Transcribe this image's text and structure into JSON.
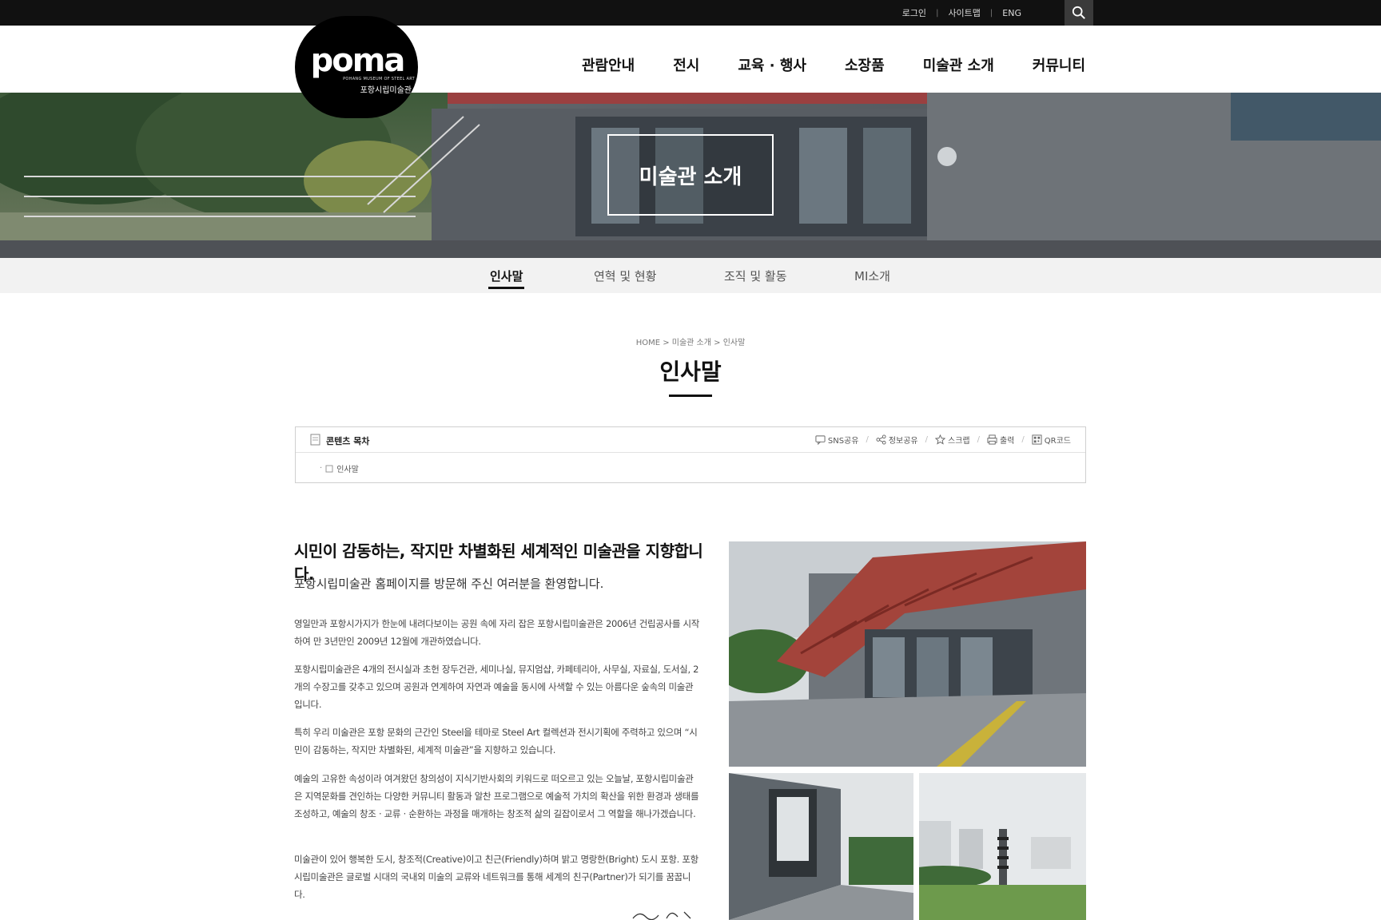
{
  "util": {
    "login": "로그인",
    "sitemap": "사이트맵",
    "eng": "ENG",
    "separator": "|"
  },
  "logo": {
    "word": "poma",
    "sub_en": "POHANG MUSEUM OF STEEL ART",
    "sub_ko": "포항시립미술관"
  },
  "gnb": [
    "관람안내",
    "전시",
    "교육 · 행사",
    "소장품",
    "미술관 소개",
    "커뮤니티"
  ],
  "hero": {
    "title": "미술관 소개"
  },
  "subnav": [
    "인사말",
    "연혁 및 현황",
    "조직 및 활동",
    "MI소개"
  ],
  "breadcrumb": "HOME > 미술관 소개 > 인사말",
  "page_title": "인사말",
  "contents": {
    "label": "콘텐츠 목차",
    "tools": [
      "SNS공유",
      "정보공유",
      "스크랩",
      "출력",
      "QR코드"
    ],
    "items": [
      "인사말"
    ],
    "slash": "/"
  },
  "article": {
    "headline": "시민이 감동하는, 작지만 차별화된 세계적인 미술관을 지향합니다.",
    "welcome": "포항시립미술관 홈페이지를 방문해 주신 여러분을 환영합니다.",
    "paragraphs": [
      "영일만과 포항시가지가 한눈에 내려다보이는 공원 속에 자리 잡은 포항시립미술관은 2006년 건립공사를 시작하여 만 3년만인 2009년 12월에 개관하였습니다.",
      "포항시립미술관은 4개의 전시실과 초헌 장두건관, 세미나실, 뮤지엄샵, 카페테리아, 사무실, 자료실, 도서실, 2개의 수장고를 갖추고 있으며 공원과 연계하여 자연과 예술을 동시에 사색할 수 있는 아름다운 숲속의 미술관입니다.",
      "특히 우리 미술관은 포항 문화의 근간인 Steel을 테마로 Steel Art 컬렉션과 전시기획에 주력하고 있으며 “시민이 감동하는, 작지만 차별화된, 세계적 미술관”을 지향하고 있습니다.",
      "예술의 고유한 속성이라 여겨왔던 창의성이 지식기반사회의 키워드로 떠오르고 있는 오늘날, 포항시립미술관은 지역문화를 견인하는 다양한 커뮤니티 활동과 알찬 프로그램으로 예술적 가치의 확산을 위한 환경과 생태를 조성하고, 예술의 창조 · 교류 · 순환하는 과정을 매개하는 창조적 삶의 길잡이로서 그 역할을 해나가겠습니다.",
      "미술관이 있어 행복한 도시, 창조적(Creative)이고 친근(Friendly)하며 밝고 명랑한(Bright) 도시 포항. 포항시립미술관은 글로벌 시대의 국내외 미술의 교류와 네트워크를 통해 세계의 친구(Partner)가 되기를 꿈꿉니다."
    ]
  },
  "colors": {
    "topbar": "#111111",
    "accent_red": "#b5483e",
    "subnav_bg": "#f2f2f2"
  },
  "icons": [
    "search-icon",
    "document-icon",
    "speech-bubble-icon",
    "share-icon",
    "star-icon",
    "print-icon",
    "qr-code-icon",
    "small-document-icon"
  ]
}
